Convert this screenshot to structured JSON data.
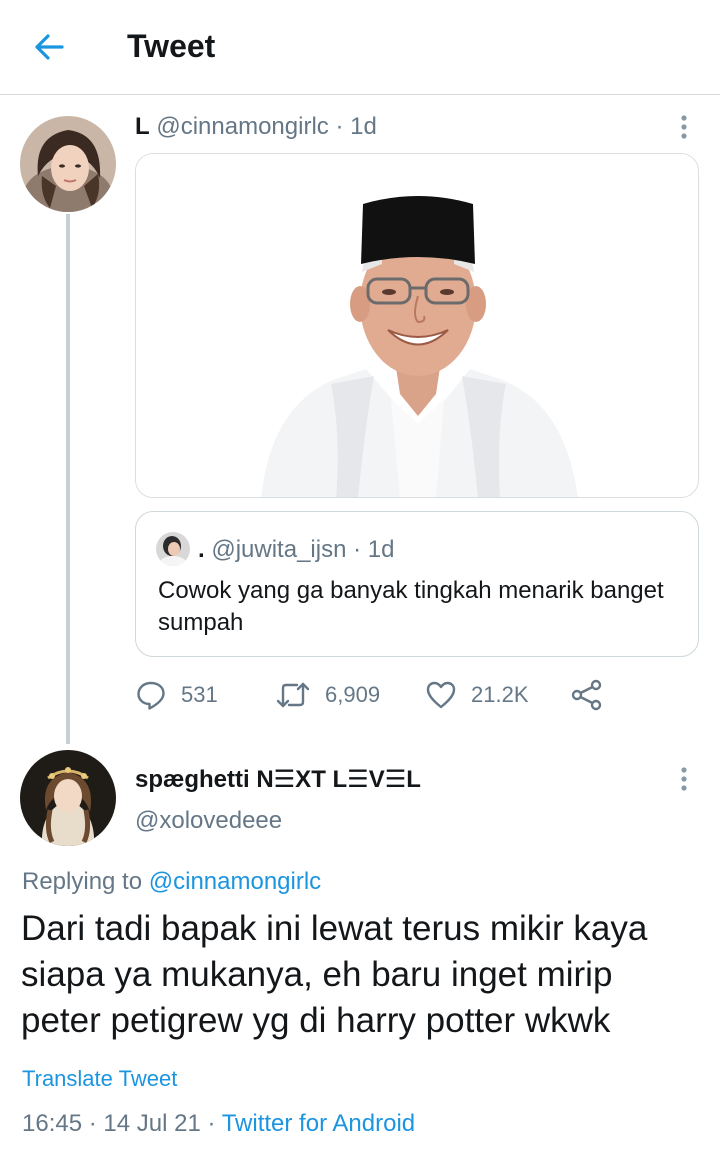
{
  "colors": {
    "accent": "#1b95e0",
    "text_primary": "#14171a",
    "text_secondary": "#657786",
    "divider": "#d9d9d9"
  },
  "header": {
    "title": "Tweet",
    "back_icon": "arrow-left-icon"
  },
  "original_tweet": {
    "display_name": "L",
    "handle": "@cinnamongirlc",
    "separator": " · ",
    "time": "1d",
    "media": "photo-of-man-in-black-cap-and-white-clothes",
    "quoted_tweet": {
      "display_name": ".",
      "handle": "@juwita_ijsn",
      "separator": " · ",
      "time": "1d",
      "text": "Cowok yang ga banyak tingkah menarik banget sumpah"
    },
    "actions": {
      "reply_count": "531",
      "retweet_count": "6,909",
      "like_count": "21.2K"
    }
  },
  "reply_tweet": {
    "display_name": "spæghetti N☰XT L☰V☰L",
    "handle": "@xolovedeee",
    "replying_prefix": "Replying to ",
    "replying_to": "@cinnamongirlc",
    "text": "Dari tadi bapak ini lewat terus mikir kaya siapa ya mukanya, eh baru inget mirip peter petigrew yg di harry potter wkwk",
    "translate_label": "Translate Tweet",
    "time": "16:45",
    "date": "14 Jul 21",
    "dot": " · ",
    "source": "Twitter for Android"
  }
}
